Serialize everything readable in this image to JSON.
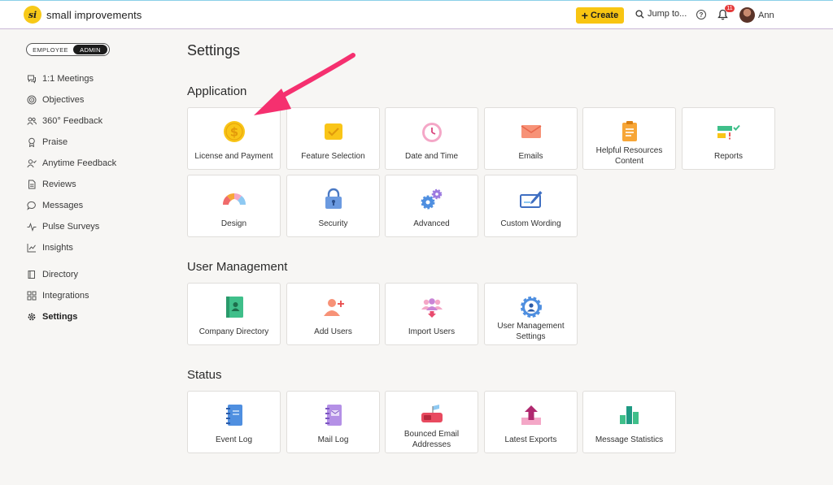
{
  "brand": {
    "name": "small improvements",
    "mark": "si"
  },
  "topbar": {
    "create_label": "Create",
    "jump_label": "Jump to...",
    "notification_count": "11",
    "user_name": "Ann"
  },
  "role_toggle": {
    "employee": "EMPLOYEE",
    "admin": "ADMIN"
  },
  "sidebar": {
    "items": [
      {
        "label": "1:1 Meetings",
        "icon": "chat-icon"
      },
      {
        "label": "Objectives",
        "icon": "target-icon"
      },
      {
        "label": "360° Feedback",
        "icon": "people-icon"
      },
      {
        "label": "Praise",
        "icon": "award-icon"
      },
      {
        "label": "Anytime Feedback",
        "icon": "person-check-icon"
      },
      {
        "label": "Reviews",
        "icon": "document-icon"
      },
      {
        "label": "Messages",
        "icon": "message-icon"
      },
      {
        "label": "Pulse Surveys",
        "icon": "pulse-icon"
      },
      {
        "label": "Insights",
        "icon": "chart-icon"
      }
    ],
    "items2": [
      {
        "label": "Directory",
        "icon": "book-icon"
      },
      {
        "label": "Integrations",
        "icon": "grid-icon"
      },
      {
        "label": "Settings",
        "icon": "gear-icon"
      }
    ]
  },
  "main": {
    "title": "Settings",
    "sections": [
      {
        "title": "Application",
        "tiles": [
          "License and Payment",
          "Feature Selection",
          "Date and Time",
          "Emails",
          "Helpful Resources Content",
          "Reports",
          "Design",
          "Security",
          "Advanced",
          "Custom Wording"
        ]
      },
      {
        "title": "User Management",
        "tiles": [
          "Company Directory",
          "Add Users",
          "Import Users",
          "User Management Settings"
        ]
      },
      {
        "title": "Status",
        "tiles": [
          "Event Log",
          "Mail Log",
          "Bounced Email Addresses",
          "Latest Exports",
          "Message Statistics"
        ]
      }
    ]
  },
  "colors": {
    "accent": "#f8c512",
    "annotation_arrow": "#f5306f",
    "active_role": "#1c1c1c"
  }
}
